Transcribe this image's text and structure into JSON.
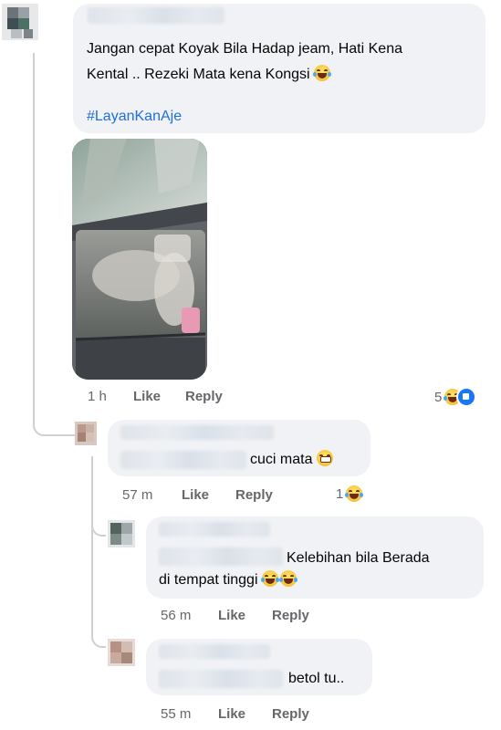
{
  "main_comment": {
    "text_line1": "Jangan cepat Koyak Bila Hadap jeam, Hati Kena",
    "text_line2": "Kental .. Rezeki Mata kena Kongsi",
    "hashtag": "#LayanKanAje",
    "emoji": "laughing-tears-emoji",
    "time": "1 h",
    "like_label": "Like",
    "reply_label": "Reply",
    "reaction_count": "5"
  },
  "replies": [
    {
      "text": "cuci mata",
      "emoji": "grimace-emoji",
      "time": "57 m",
      "like_label": "Like",
      "reply_label": "Reply",
      "reaction_count": "1"
    },
    {
      "text_line1": "Kelebihan bila Berada",
      "text_line2": "di tempat tinggi",
      "emoji": "laughing-tears-emoji",
      "time": "56 m",
      "like_label": "Like",
      "reply_label": "Reply"
    },
    {
      "text": "betol tu..",
      "time": "55 m",
      "like_label": "Like",
      "reply_label": "Reply"
    }
  ],
  "colors": {
    "bubble": "#f0f2f5",
    "meta": "#65676b",
    "hashtag": "#216fdb",
    "like_blue": "#1877f2"
  }
}
